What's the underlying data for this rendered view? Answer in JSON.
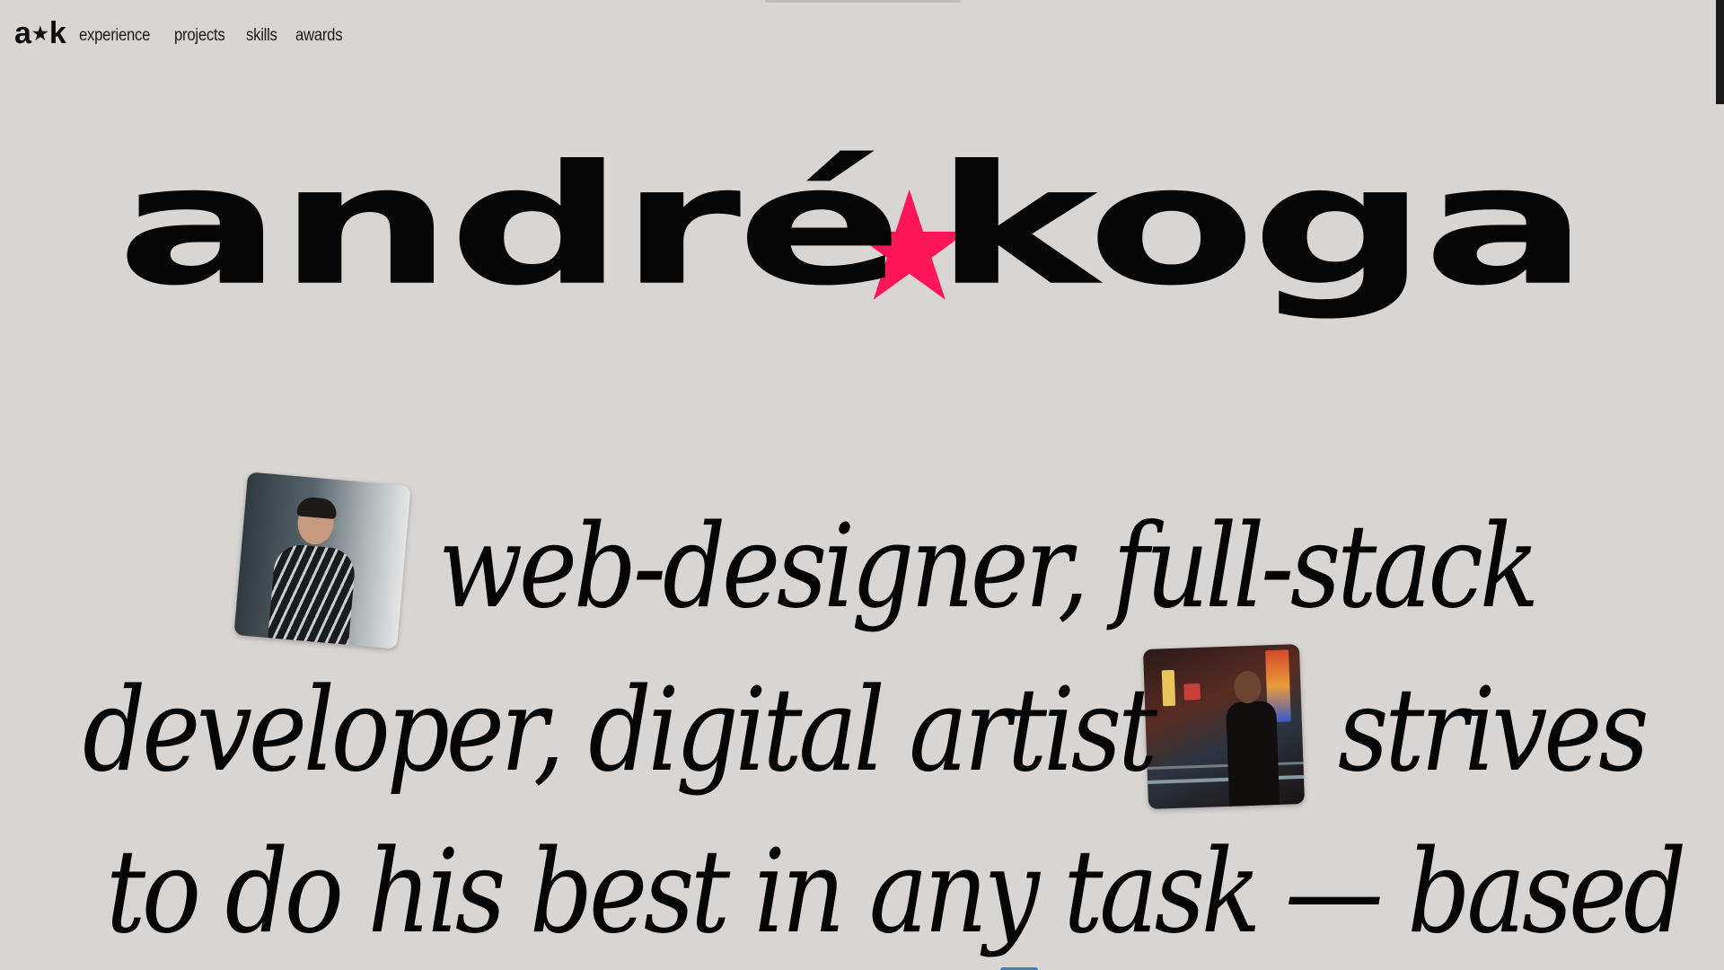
{
  "nav": {
    "logo_left": "a",
    "logo_star": "★",
    "logo_right": "k",
    "links": [
      "experience",
      "projects",
      "skills",
      "awards"
    ]
  },
  "hero": {
    "first": "andré",
    "star": "★",
    "last": "koga"
  },
  "intro": {
    "line1": "web-designer, full-stack",
    "line2a": "developer, digital artist",
    "line2b": "strives",
    "line3": "to do his best in any task — based"
  },
  "colors": {
    "background": "#d8d5d3",
    "accent": "#ff1658",
    "text": "#050505"
  }
}
